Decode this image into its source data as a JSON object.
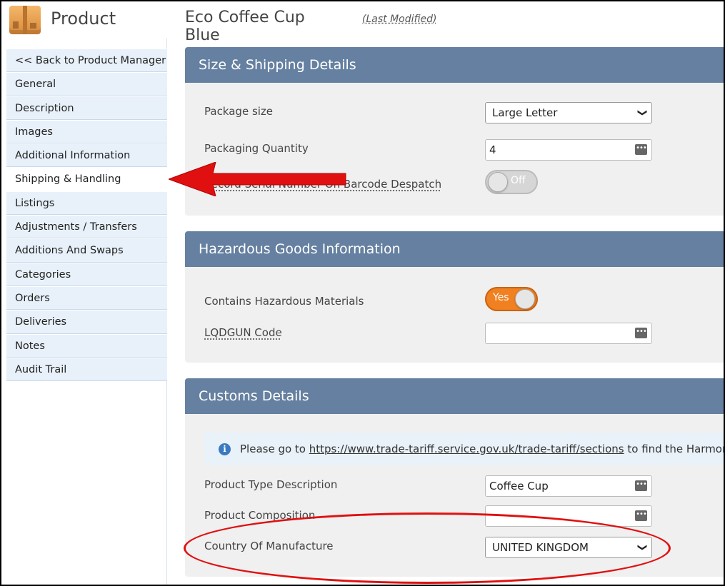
{
  "header": {
    "app_title": "Product",
    "product_name": "Eco Coffee Cup Blue",
    "last_modified": "(Last Modified)"
  },
  "sidebar": {
    "items": [
      {
        "label": "<< Back to Product Manager"
      },
      {
        "label": "General"
      },
      {
        "label": "Description"
      },
      {
        "label": "Images"
      },
      {
        "label": "Additional Information"
      },
      {
        "label": "Shipping & Handling",
        "active": true
      },
      {
        "label": "Listings"
      },
      {
        "label": "Adjustments / Transfers"
      },
      {
        "label": "Additions And Swaps"
      },
      {
        "label": "Categories"
      },
      {
        "label": "Orders"
      },
      {
        "label": "Deliveries"
      },
      {
        "label": "Notes"
      },
      {
        "label": "Audit Trail"
      }
    ]
  },
  "size_shipping": {
    "title": "Size & Shipping Details",
    "package_size_label": "Package size",
    "package_size_value": "Large Letter",
    "packaging_qty_label": "Packaging Quantity",
    "packaging_qty_value": "4",
    "serial_label": "Record Serial Number On Barcode Despatch",
    "serial_toggle": "Off"
  },
  "hazardous": {
    "title": "Hazardous Goods Information",
    "contains_label": "Contains Hazardous Materials",
    "contains_toggle": "Yes",
    "lqdgun_label": "LQDGUN Code",
    "lqdgun_value": ""
  },
  "customs": {
    "title": "Customs Details",
    "info_prefix": "Please go to ",
    "info_link": "https://www.trade-tariff.service.gov.uk/trade-tariff/sections",
    "info_suffix": " to find the Harmonisat",
    "type_desc_label": "Product Type Description",
    "type_desc_value": "Coffee Cup",
    "composition_label": "Product Composition",
    "composition_value": "",
    "country_label": "Country Of Manufacture",
    "country_value": "UNITED KINGDOM"
  },
  "colors": {
    "panel_header": "#6580a0",
    "sidebar_bg": "#e8f1fa",
    "toggle_on": "#f08020",
    "annotation": "#e01010"
  }
}
